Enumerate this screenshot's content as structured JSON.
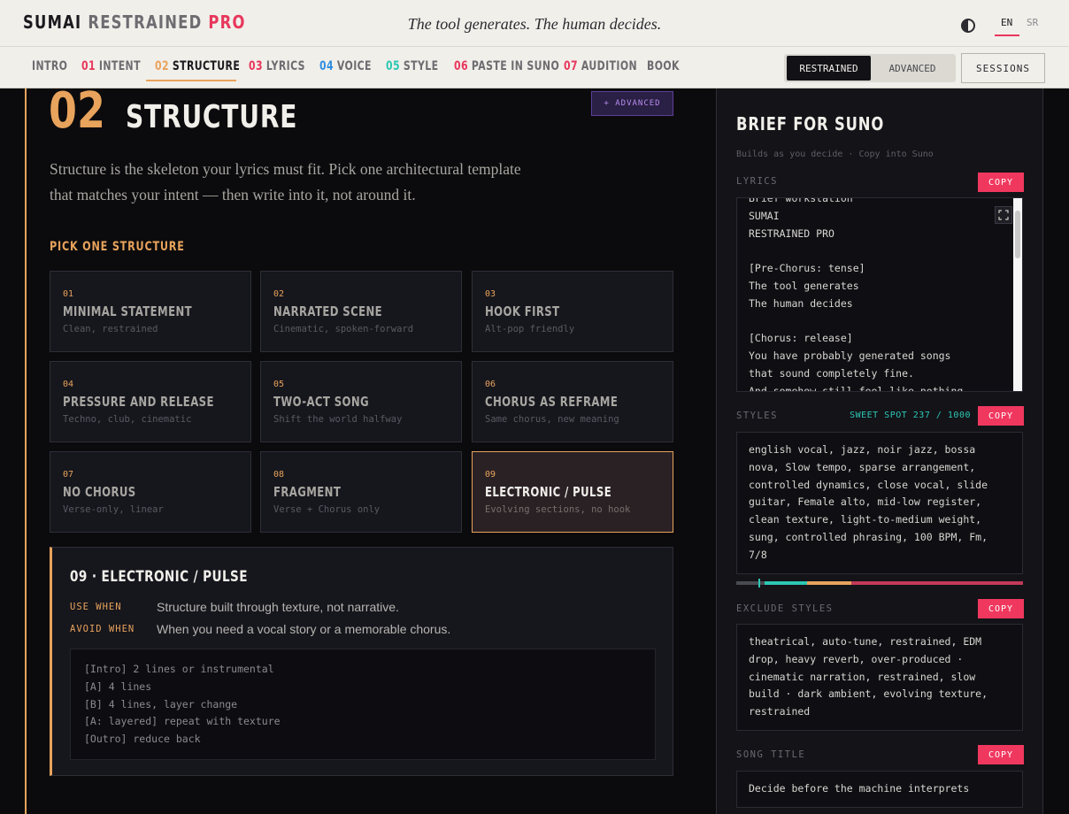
{
  "header": {
    "brand": {
      "part1": "SUMAI",
      "part2": "RESTRAINED",
      "part3": "PRO"
    },
    "tagline": "The tool generates. The human decides.",
    "theme_icon": "contrast-icon",
    "languages": [
      {
        "code": "EN",
        "active": true
      },
      {
        "code": "SR",
        "active": false
      }
    ]
  },
  "nav": {
    "items": [
      {
        "num": "",
        "label": "INTRO",
        "color": "#6d6c70"
      },
      {
        "num": "01",
        "label": "INTENT",
        "color": "#e8375c"
      },
      {
        "num": "02",
        "label": "STRUCTURE",
        "color": "#e8a35c",
        "active": true
      },
      {
        "num": "03",
        "label": "LYRICS",
        "color": "#e8375c"
      },
      {
        "num": "04",
        "label": "VOICE",
        "color": "#2f8ee0"
      },
      {
        "num": "05",
        "label": "STYLE",
        "color": "#2dc7b4"
      },
      {
        "num": "06",
        "label": "PASTE IN SUNO",
        "color": "#e8375c"
      },
      {
        "num": "07",
        "label": "AUDITION",
        "color": "#e8375c"
      },
      {
        "num": "",
        "label": "BOOK",
        "color": "#6d6c70"
      }
    ],
    "modes": {
      "active": "RESTRAINED",
      "inactive": "ADVANCED"
    },
    "sessions": "SESSIONS"
  },
  "main": {
    "step_num": "02",
    "title": "STRUCTURE",
    "advanced_chip": "+ ADVANCED",
    "intro": "Structure is the skeleton your lyrics must fit. Pick one architectural template that matches your intent — then write into it, not around it.",
    "section_label": "PICK ONE STRUCTURE",
    "cards": [
      {
        "num": "01",
        "title": "MINIMAL STATEMENT",
        "sub": "Clean, restrained"
      },
      {
        "num": "02",
        "title": "NARRATED SCENE",
        "sub": "Cinematic, spoken-forward"
      },
      {
        "num": "03",
        "title": "HOOK FIRST",
        "sub": "Alt-pop friendly"
      },
      {
        "num": "04",
        "title": "PRESSURE AND RELEASE",
        "sub": "Techno, club, cinematic"
      },
      {
        "num": "05",
        "title": "TWO-ACT SONG",
        "sub": "Shift the world halfway"
      },
      {
        "num": "06",
        "title": "CHORUS AS REFRAME",
        "sub": "Same chorus, new meaning"
      },
      {
        "num": "07",
        "title": "NO CHORUS",
        "sub": "Verse-only, linear"
      },
      {
        "num": "08",
        "title": "FRAGMENT",
        "sub": "Verse + Chorus only"
      },
      {
        "num": "09",
        "title": "ELECTRONIC / PULSE",
        "sub": "Evolving sections, no hook",
        "selected": true
      }
    ],
    "detail": {
      "title": "09 · ELECTRONIC / PULSE",
      "use_when_label": "USE WHEN",
      "use_when": "Structure built through texture, not narrative.",
      "avoid_when_label": "AVOID WHEN",
      "avoid_when": "When you need a vocal story or a memorable chorus.",
      "code": [
        "[Intro] 2 lines or instrumental",
        "[A] 4 lines",
        "[B] 4 lines, layer change",
        "[A: layered] repeat with texture",
        "[Outro] reduce back"
      ]
    }
  },
  "panel": {
    "title": "BRIEF FOR SUNO",
    "subtitle": "Builds as you decide · Copy into Suno",
    "copy_label": "COPY",
    "lyrics_label": "LYRICS",
    "lyrics": "Brief workstation\nSUMAI\nRESTRAINED PRO\n\n[Pre-Chorus: tense]\nThe tool generates\nThe human decides\n\n[Chorus: release]\nYou have probably generated songs\nthat sound completely fine.\nAnd somehow still feel like nothing.",
    "styles_label": "STYLES",
    "sweet_spot": "SWEET SPOT 237 / 1000",
    "styles_count": 237,
    "styles_max": 1000,
    "styles": "english vocal, jazz, noir jazz, bossa nova, Slow tempo, sparse arrangement, controlled dynamics, close vocal, slide guitar, Female alto, mid-low register, clean texture, light-to-medium weight, sung, controlled phrasing, 100 BPM, Fm, 7/8",
    "exclude_label": "EXCLUDE STYLES",
    "exclude": "theatrical, auto-tune, restrained, EDM drop, heavy reverb, over-produced · cinematic narration, restrained, slow build · dark ambient, evolving texture, restrained",
    "song_title_label": "SONG TITLE",
    "song_title": "Decide before the machine interprets"
  }
}
